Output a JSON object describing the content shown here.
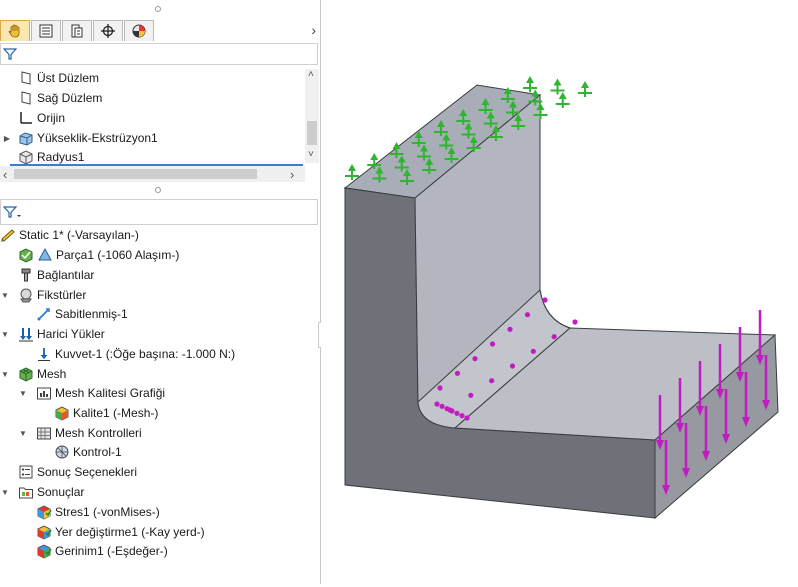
{
  "top_tree": {
    "items": [
      {
        "label": "Üst Düzlem",
        "icon": "plane-icon"
      },
      {
        "label": "Sağ Düzlem",
        "icon": "plane-icon"
      },
      {
        "label": "Orijin",
        "icon": "origin-icon"
      },
      {
        "label": "Yükseklik-Ekstrüzyon1",
        "icon": "extrude-icon"
      },
      {
        "label": "Radyus1",
        "icon": "fillet-icon"
      }
    ]
  },
  "tabs": [
    {
      "name": "featuremanager-tab",
      "icon": "hand-icon"
    },
    {
      "name": "propertymanager-tab",
      "icon": "list-icon"
    },
    {
      "name": "configuration-tab",
      "icon": "config-icon"
    },
    {
      "name": "dimxpert-tab",
      "icon": "crosshair-icon"
    },
    {
      "name": "display-tab",
      "icon": "pie-icon"
    }
  ],
  "sim_tree": {
    "study": "Static 1* (-Varsayılan-)",
    "part": "Parça1 (-1060 Alaşım-)",
    "connections": "Bağlantılar",
    "fixtures": "Fikstürler",
    "fixture_item": "Sabitlenmiş-1",
    "external_loads": "Harici Yükler",
    "load_item": "Kuvvet-1 (:Öğe başına: -1.000 N:)",
    "mesh": "Mesh",
    "mesh_quality": "Mesh Kalitesi Grafiği",
    "quality_item": "Kalite1 (-Mesh-)",
    "mesh_controls": "Mesh Kontrolleri",
    "control_item": "Kontrol-1",
    "result_options": "Sonuç Seçenekleri",
    "results": "Sonuçlar",
    "result_stress": "Stres1 (-vonMises-)",
    "result_disp": "Yer değiştirme1 (-Kay yerd-)",
    "result_strain": "Gerinim1 (-Eşdeğer-)"
  },
  "colors": {
    "fixture": "#2fb52f",
    "load": "#c21bc2",
    "body_top": "#a9adb8",
    "body_front": "#76797f",
    "body_side": "#96999f"
  }
}
